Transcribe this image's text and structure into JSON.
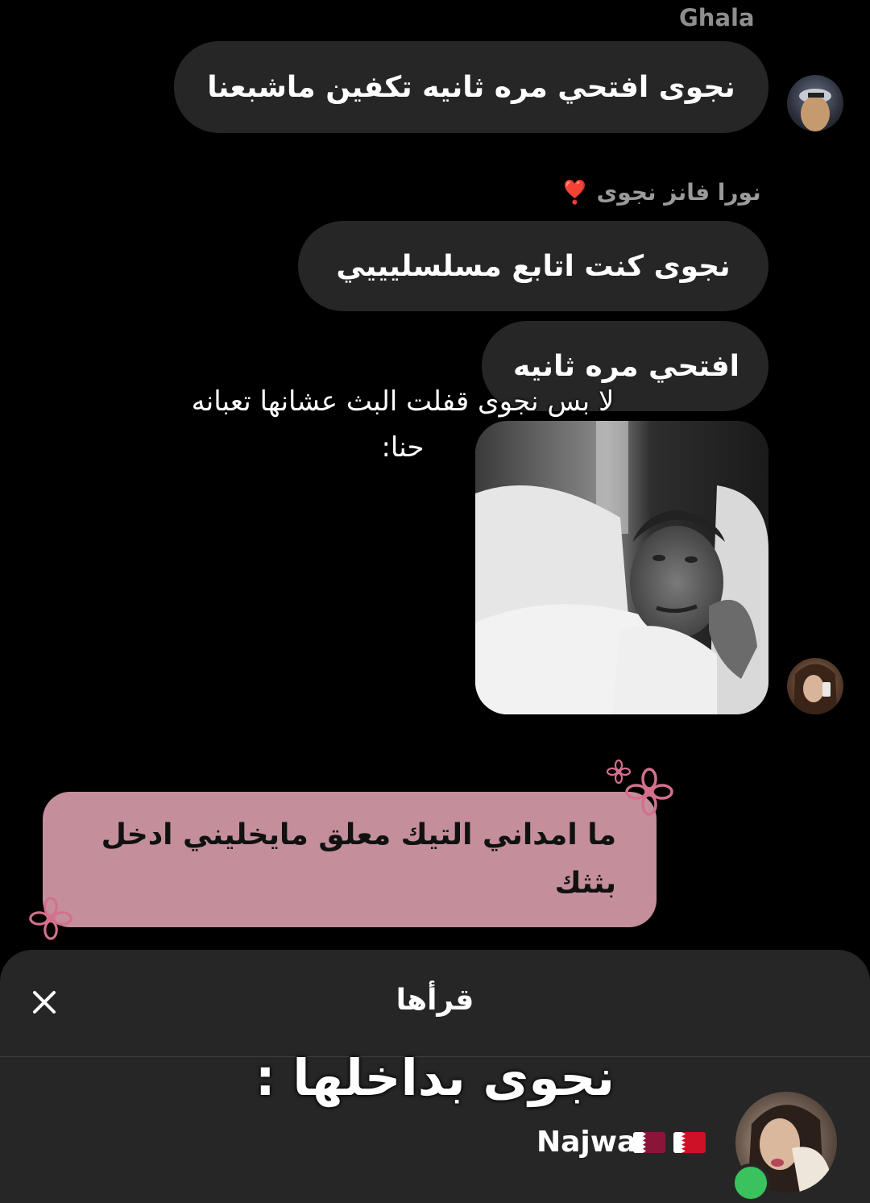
{
  "conversation": {
    "sender_top": "Ghala",
    "msg1": "نجوى افتحي مره ثانيه تكفين ماشبعنا",
    "reply_label": "نورا فانز نجوى",
    "reply_heart": "❣️",
    "msg2": "نجوى كنت اتابع مسلسليييي",
    "msg3": "افتحي مره ثانيه",
    "overlay_line1": "لا بس نجوى قفلت البث عشانها تعبانه",
    "overlay_line2": "حنا:",
    "photo_icon": "person-in-bed-photo",
    "pink_message": "ما امداني التيك معلق مايخليني ادخل بثثك"
  },
  "sheet": {
    "title": "قرأها",
    "close_icon": "close-icon",
    "caption": "نجوى بداخلها :",
    "reader_name": "Najwa",
    "flags": [
      "qatar-flag",
      "bahrain-flag"
    ]
  },
  "colors": {
    "background": "#000000",
    "bubble": "#262626",
    "pink_box": "#c48e9b",
    "flower": "#d4708e",
    "online": "#3ac25e"
  }
}
